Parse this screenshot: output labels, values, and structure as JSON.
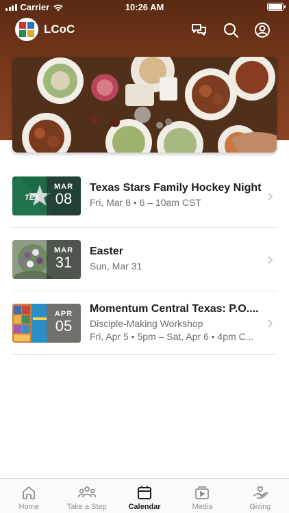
{
  "status": {
    "carrier": "Carrier",
    "time": "10:26 AM"
  },
  "app": {
    "title": "LCoC"
  },
  "icons": {
    "messages": "messages-icon",
    "search": "search-icon",
    "profile": "profile-icon"
  },
  "events": [
    {
      "title": "Texas Stars Family Hockey Night",
      "lines": [
        "Fri, Mar 8 • 6 – 10am CST"
      ],
      "month": "MAR",
      "day": "08",
      "thumb_color": "#1f6b4a"
    },
    {
      "title": "Easter",
      "lines": [
        "Sun, Mar 31"
      ],
      "month": "MAR",
      "day": "31",
      "thumb_color": "#7c8c7a"
    },
    {
      "title": "Momentum Central Texas: P.O....",
      "lines": [
        "Disciple-Making Workshop",
        "Fri, Apr 5 • 5pm – Sat, Apr 6 • 4pm C..."
      ],
      "month": "APR",
      "day": "05",
      "thumb_color": "#2a7fb5"
    }
  ],
  "tabs": [
    {
      "label": "Home",
      "icon": "home-icon",
      "active": false
    },
    {
      "label": "Take a Step",
      "icon": "people-icon",
      "active": false
    },
    {
      "label": "Calendar",
      "icon": "calendar-icon",
      "active": true
    },
    {
      "label": "Media",
      "icon": "media-icon",
      "active": false
    },
    {
      "label": "Giving",
      "icon": "giving-icon",
      "active": false
    }
  ],
  "colors": {
    "header_brown": "#6a3219",
    "active_tab": "#1c1c1e",
    "inactive_tab": "#8e8e93"
  }
}
